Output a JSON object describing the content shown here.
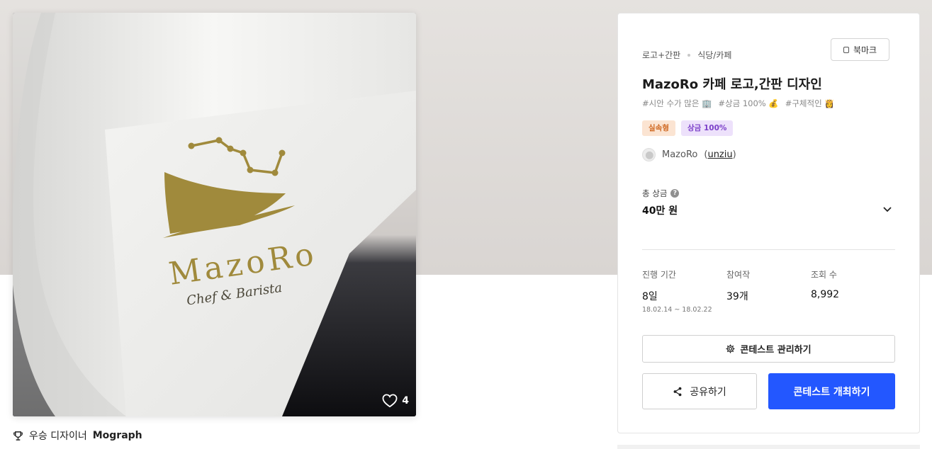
{
  "artwork": {
    "logo_name": "MazoRo",
    "logo_tagline": "Chef & Barista",
    "likes": "4"
  },
  "caption": {
    "label": "우승 디자이너",
    "designer": "Mograph"
  },
  "contest": {
    "categories": [
      "로고+간판",
      "식당/카페"
    ],
    "bookmark_label": "북마크",
    "title": "MazoRo 카페 로고,간판 디자인",
    "tags": [
      "#시안 수가 많은 🏢",
      "#상금 100% 💰",
      "#구체적인 👸"
    ],
    "badges": [
      "실속형",
      "상금 100%"
    ],
    "host_name": "MazoRo",
    "host_id": "unziu",
    "prize_label": "총 상금",
    "prize_value": "40만 원",
    "stats": {
      "period_label": "진행 기간",
      "period_value": "8일",
      "period_dates": "18.02.14 ~ 18.02.22",
      "entries_label": "참여작",
      "entries_value": "39개",
      "views_label": "조회 수",
      "views_value": "8,992"
    },
    "manage_button": "콘테스트 관리하기",
    "share_button": "공유하기",
    "host_button": "콘테스트 개최하기"
  },
  "colors": {
    "primary": "#2357ff",
    "badge_orange_bg": "#fbe4d2",
    "badge_purple_bg": "#ede1fb",
    "logo_gold": "#a08a3c"
  }
}
